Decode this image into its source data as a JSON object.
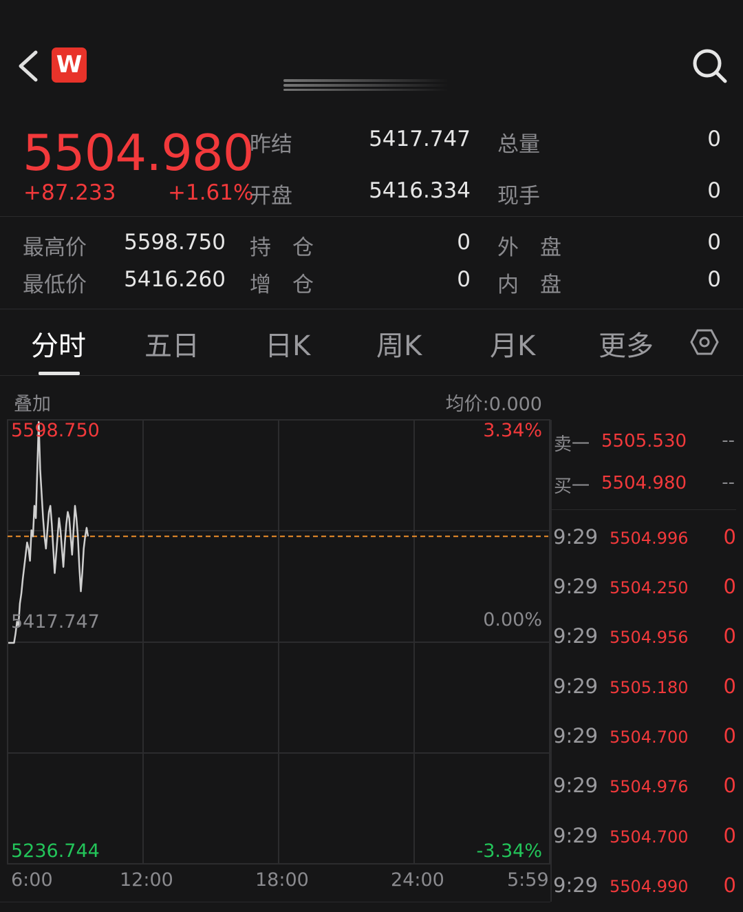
{
  "header": {
    "logo_letter": "W",
    "back_icon": "chevron-left-icon",
    "search_icon": "search-icon"
  },
  "quote": {
    "last_price": "5504.980",
    "change": "+87.233",
    "change_pct": "+1.61%",
    "prev_settle_label": "昨结",
    "prev_settle": "5417.747",
    "volume_label": "总量",
    "volume": "0",
    "open_label": "开盘",
    "open": "5416.334",
    "current_hand_label": "现手",
    "current_hand": "0",
    "high_label": "最高价",
    "high": "5598.750",
    "position_label": "持　仓",
    "position": "0",
    "outer_label": "外　盘",
    "outer": "0",
    "low_label": "最低价",
    "low": "5416.260",
    "add_position_label": "增　仓",
    "add_position": "0",
    "inner_label": "内　盘",
    "inner": "0"
  },
  "tabs": [
    {
      "label": "分时"
    },
    {
      "label": "五日"
    },
    {
      "label": "日K"
    },
    {
      "label": "周K"
    },
    {
      "label": "月K"
    },
    {
      "label": "更多"
    }
  ],
  "chart": {
    "overlay_label": "叠加",
    "avg_label": "均价:0.000",
    "y_top": "5598.750",
    "y_mid": "5417.747",
    "y_bottom": "5236.744",
    "pct_top": "3.34%",
    "pct_mid": "0.00%",
    "pct_bottom": "-3.34%",
    "x_ticks": [
      "6:00",
      "12:00",
      "18:00",
      "24:00",
      "5:59"
    ]
  },
  "order_book": {
    "sell1_label": "卖一",
    "sell1_price": "5505.530",
    "sell1_vol": "--",
    "buy1_label": "买一",
    "buy1_price": "5504.980",
    "buy1_vol": "--"
  },
  "ticks": [
    {
      "time": "9:29",
      "price": "5504.996",
      "vol": "0"
    },
    {
      "time": "9:29",
      "price": "5504.250",
      "vol": "0"
    },
    {
      "time": "9:29",
      "price": "5504.956",
      "vol": "0"
    },
    {
      "time": "9:29",
      "price": "5505.180",
      "vol": "0"
    },
    {
      "time": "9:29",
      "price": "5504.700",
      "vol": "0"
    },
    {
      "time": "9:29",
      "price": "5504.976",
      "vol": "0"
    },
    {
      "time": "9:29",
      "price": "5504.700",
      "vol": "0"
    },
    {
      "time": "9:29",
      "price": "5504.990",
      "vol": "0"
    }
  ],
  "chart_data": {
    "type": "line",
    "ylim": [
      5236.744,
      5598.75
    ],
    "prev_close": 5417.747,
    "current_price": 5504.98,
    "x_range": [
      "6:00",
      "5:59"
    ],
    "series": [
      {
        "values": [
          5417.747,
          5417.747,
          5417.747,
          5417.747,
          5417.747,
          5425,
          5435,
          5432,
          5450,
          5458,
          5470,
          5480,
          5490,
          5500,
          5495,
          5485,
          5510,
          5505,
          5530,
          5520,
          5560,
          5598.75,
          5560,
          5540,
          5520,
          5505,
          5495,
          5510,
          5525,
          5530,
          5515,
          5495,
          5475,
          5490,
          5505,
          5520,
          5510,
          5495,
          5480,
          5500,
          5515,
          5525,
          5520,
          5505,
          5490,
          5510,
          5530,
          5520,
          5505,
          5480,
          5460,
          5475,
          5495,
          5505,
          5512,
          5504.98
        ]
      }
    ]
  }
}
